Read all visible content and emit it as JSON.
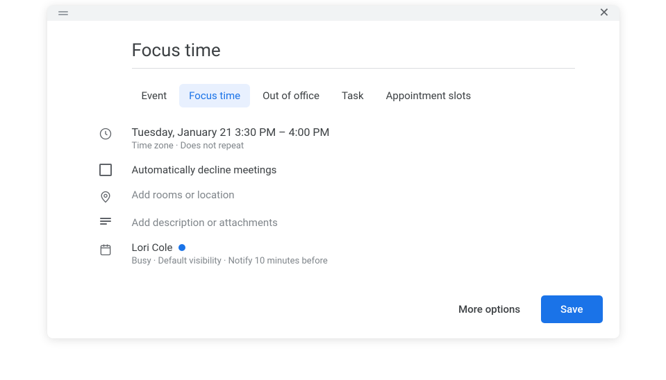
{
  "title": "Focus time",
  "tabs": [
    {
      "label": "Event"
    },
    {
      "label": "Focus time"
    },
    {
      "label": "Out of office"
    },
    {
      "label": "Task"
    },
    {
      "label": "Appointment slots"
    }
  ],
  "datetime": {
    "primary": "Tuesday, January 21   3:30 PM – 4:00 PM",
    "secondary": "Time zone · Does not repeat"
  },
  "decline": {
    "label": "Automatically decline meetings"
  },
  "location": {
    "placeholder": "Add rooms or location"
  },
  "description": {
    "placeholder": "Add description or attachments"
  },
  "calendar": {
    "owner": "Lori Cole",
    "meta": "Busy · Default visibility · Notify 10 minutes before",
    "color": "#1a73e8"
  },
  "footer": {
    "more_options": "More options",
    "save": "Save"
  }
}
